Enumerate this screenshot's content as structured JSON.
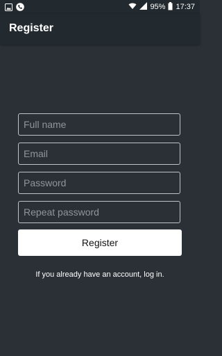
{
  "status_bar": {
    "battery_percent": "95%",
    "time": "17:37",
    "icons": [
      "gallery-icon",
      "phone-icon",
      "wifi-icon",
      "signal-icon",
      "battery-icon"
    ]
  },
  "app_bar": {
    "title": "Register"
  },
  "form": {
    "full_name_placeholder": "Full name",
    "email_placeholder": "Email",
    "password_placeholder": "Password",
    "repeat_password_placeholder": "Repeat password",
    "register_label": "Register"
  },
  "footer": {
    "login_text": "If you already have an account, log in."
  },
  "colors": {
    "background": "#2a3035",
    "app_bar": "#232a2f",
    "field_border": "#bfc3c6",
    "button": "#ffffff"
  }
}
